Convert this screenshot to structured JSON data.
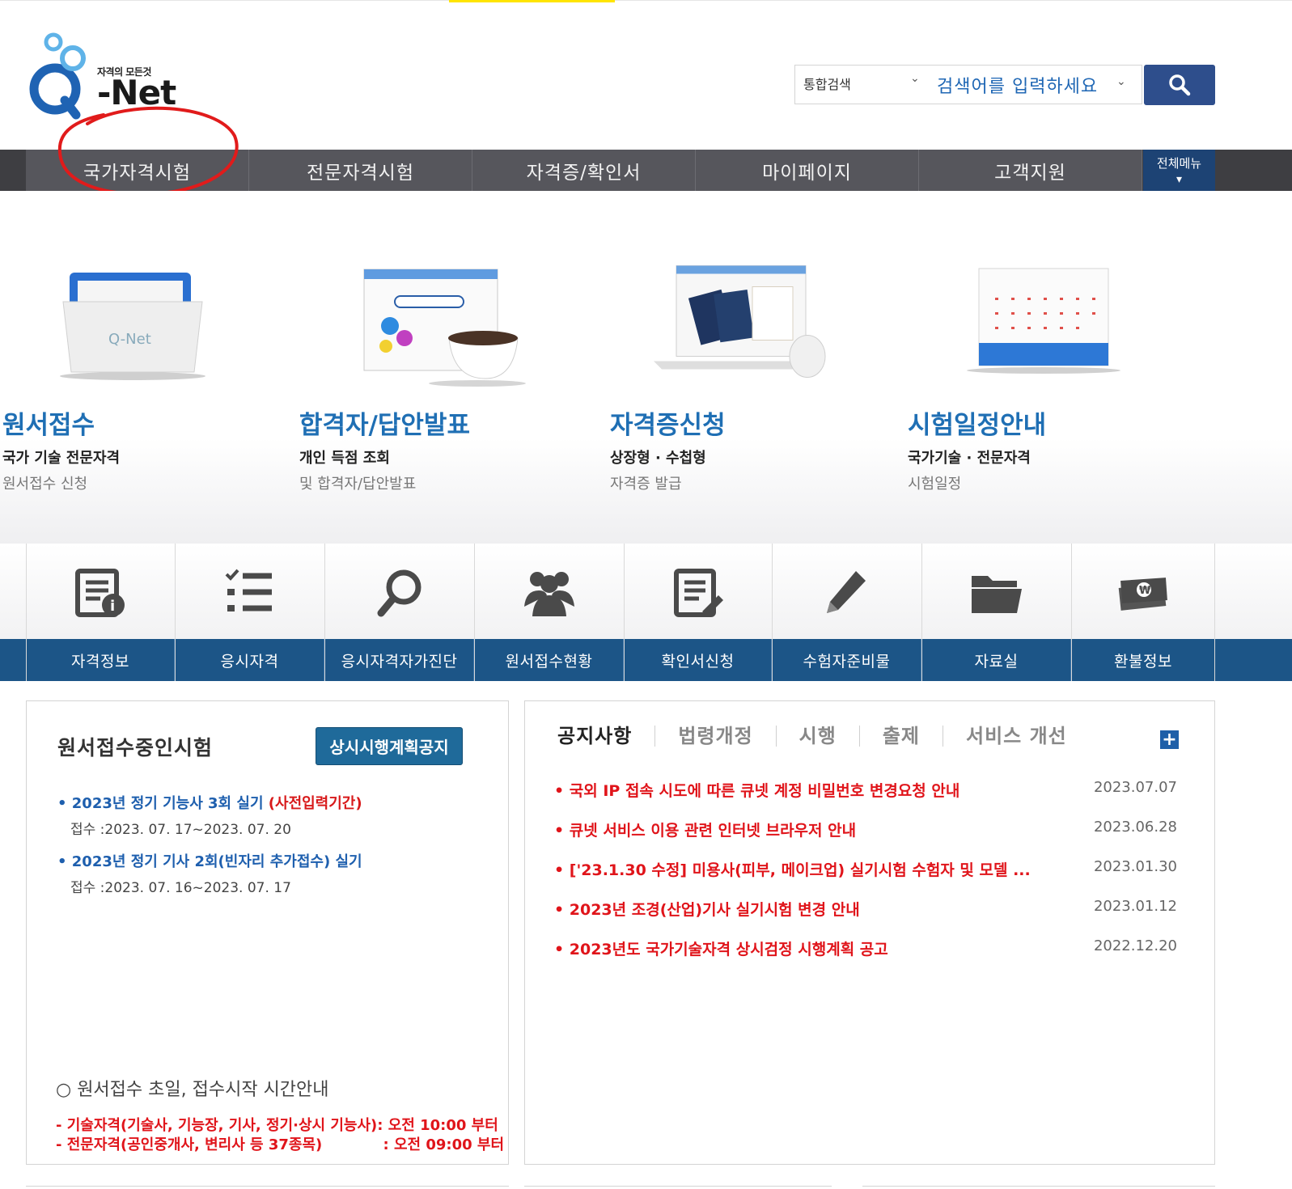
{
  "header": {
    "logo_tagline": "자격의 모든것",
    "logo_text": "-Net",
    "search_category": "통합검색",
    "search_placeholder": "검색어를 입력하세요"
  },
  "gnb": {
    "items": [
      "국가자격시험",
      "전문자격시험",
      "자격증/확인서",
      "마이페이지",
      "고객지원"
    ],
    "all_menu": "전체메뉴"
  },
  "hero": [
    {
      "title": "원서접수",
      "line1": "국가 기술 전문자격",
      "line2": "원서접수 신청"
    },
    {
      "title": "합격자/답안발표",
      "line1": "개인 득점 조회",
      "line2": "및 합격자/답안발표"
    },
    {
      "title": "자격증신청",
      "line1": "상장형 · 수첩형",
      "line2": "자격증 발급"
    },
    {
      "title": "시험일정안내",
      "line1": "국가기술 · 전문자격",
      "line2": "시험일정"
    }
  ],
  "quick_menu": [
    {
      "label": "자격정보",
      "icon": "document-info-icon"
    },
    {
      "label": "응시자격",
      "icon": "checklist-icon"
    },
    {
      "label": "응시자격자가진단",
      "icon": "magnifier-icon"
    },
    {
      "label": "원서접수현황",
      "icon": "people-icon"
    },
    {
      "label": "확인서신청",
      "icon": "document-edit-icon"
    },
    {
      "label": "수험자준비물",
      "icon": "pencil-icon"
    },
    {
      "label": "자료실",
      "icon": "folder-icon"
    },
    {
      "label": "환불정보",
      "icon": "money-icon"
    }
  ],
  "exam_panel": {
    "title": "원서접수중인시험",
    "button": "상시시행계획공지",
    "exams": [
      {
        "title": "2023년 정기 기능사 3회 실기 ",
        "note": "(사전입력기간)",
        "date": "접수 :2023. 07. 17~2023. 07. 20"
      },
      {
        "title": "2023년 정기 기사 2회(빈자리 추가접수) 실기",
        "note": "",
        "date": "접수 :2023. 07. 16~2023. 07. 17"
      }
    ],
    "footer_title": "○ 원서접수 초일, 접수시작 시간안내",
    "footer_lines": [
      "- 기술자격(기술사, 기능장, 기사, 정기·상시 기능사): 오전 10:00 부터",
      "- 전문자격(공인중개사, 변리사 등 37종목)            : 오전 09:00 부터"
    ]
  },
  "notice_panel": {
    "tabs": [
      "공지사항",
      "법령개정",
      "시행",
      "출제",
      "서비스 개선"
    ],
    "plus": "+",
    "notices": [
      {
        "title": "국외 IP 접속 시도에 따른 큐넷 계정 비밀번호 변경요청 안내",
        "date": "2023.07.07"
      },
      {
        "title": "큐넷 서비스 이용 관련 인터넷 브라우저 안내",
        "date": "2023.06.28"
      },
      {
        "title": "['23.1.30 수정] 미용사(피부, 메이크업) 실기시험 수험자 및 모델 ...",
        "date": "2023.01.30"
      },
      {
        "title": "2023년 조경(산업)기사 실기시험 변경 안내",
        "date": "2023.01.12"
      },
      {
        "title": "2023년도 국가기술자격 상시검정 시행계획 공고",
        "date": "2022.12.20"
      }
    ]
  },
  "colors": {
    "gnb_bg": "#56565c",
    "accent_blue": "#1f6fb4",
    "quick_bar": "#1c5587",
    "notice_red": "#e0141a",
    "annotation_circle": "#e11b1b"
  }
}
